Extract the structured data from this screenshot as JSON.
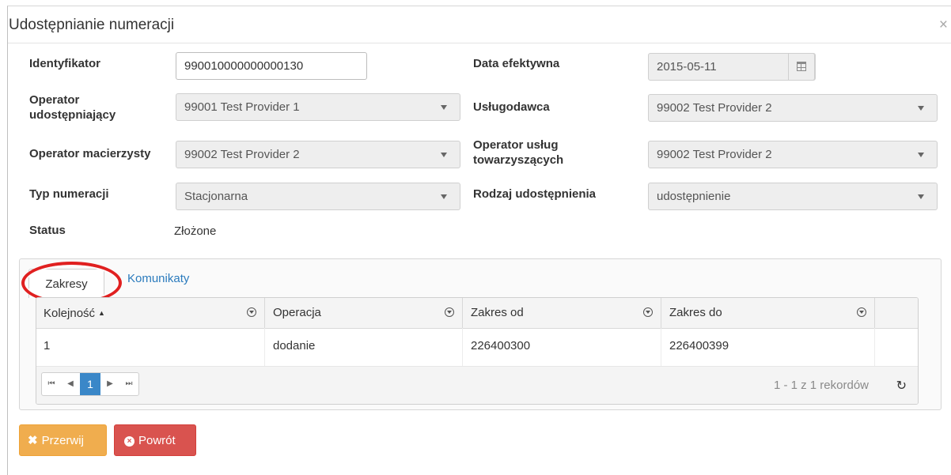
{
  "dialog": {
    "title": "Udostępnianie numeracji",
    "close_symbol": "×"
  },
  "form": {
    "identyfikator": {
      "label": "Identyfikator",
      "value": "990010000000000130"
    },
    "data_efektywna": {
      "label": "Data efektywna",
      "value": "2015-05-11"
    },
    "operator_udostepniajacy": {
      "label_line1": "Operator",
      "label_line2": "udostępniający",
      "value": "99001 Test Provider 1"
    },
    "uslugodawca": {
      "label": "Usługodawca",
      "value": "99002 Test Provider 2"
    },
    "operator_macierzysty": {
      "label": "Operator macierzysty",
      "value": "99002 Test Provider 2"
    },
    "operator_uslug": {
      "label_line1": "Operator usług",
      "label_line2": "towarzyszących",
      "value": "99002 Test Provider 2"
    },
    "typ_numeracji": {
      "label": "Typ numeracji",
      "value": "Stacjonarna"
    },
    "rodzaj_udostepnienia": {
      "label": "Rodzaj udostępnienia",
      "value": "udostępnienie"
    },
    "status": {
      "label": "Status",
      "value": "Złożone"
    }
  },
  "tabs": [
    {
      "label": "Zakresy",
      "active": true
    },
    {
      "label": "Komunikaty",
      "active": false
    }
  ],
  "grid": {
    "columns": [
      "Kolejność",
      "Operacja",
      "Zakres od",
      "Zakres do"
    ],
    "sort_indicator": "▲",
    "rows": [
      [
        "1",
        "dodanie",
        "226400300",
        "226400399"
      ]
    ],
    "pager": {
      "first": "⏮",
      "prev": "◀",
      "current_page": "1",
      "next": "▶",
      "last": "⏭",
      "info": "1 - 1 z 1 rekordów",
      "refresh": "↻"
    }
  },
  "buttons": {
    "przerwij": {
      "label": "Przerwij",
      "icon": "✖",
      "color": "#f0ad4e"
    },
    "powrot": {
      "label": "Powrót",
      "icon": "×",
      "color": "#d9534f"
    }
  },
  "highlight_color": "#e02020"
}
